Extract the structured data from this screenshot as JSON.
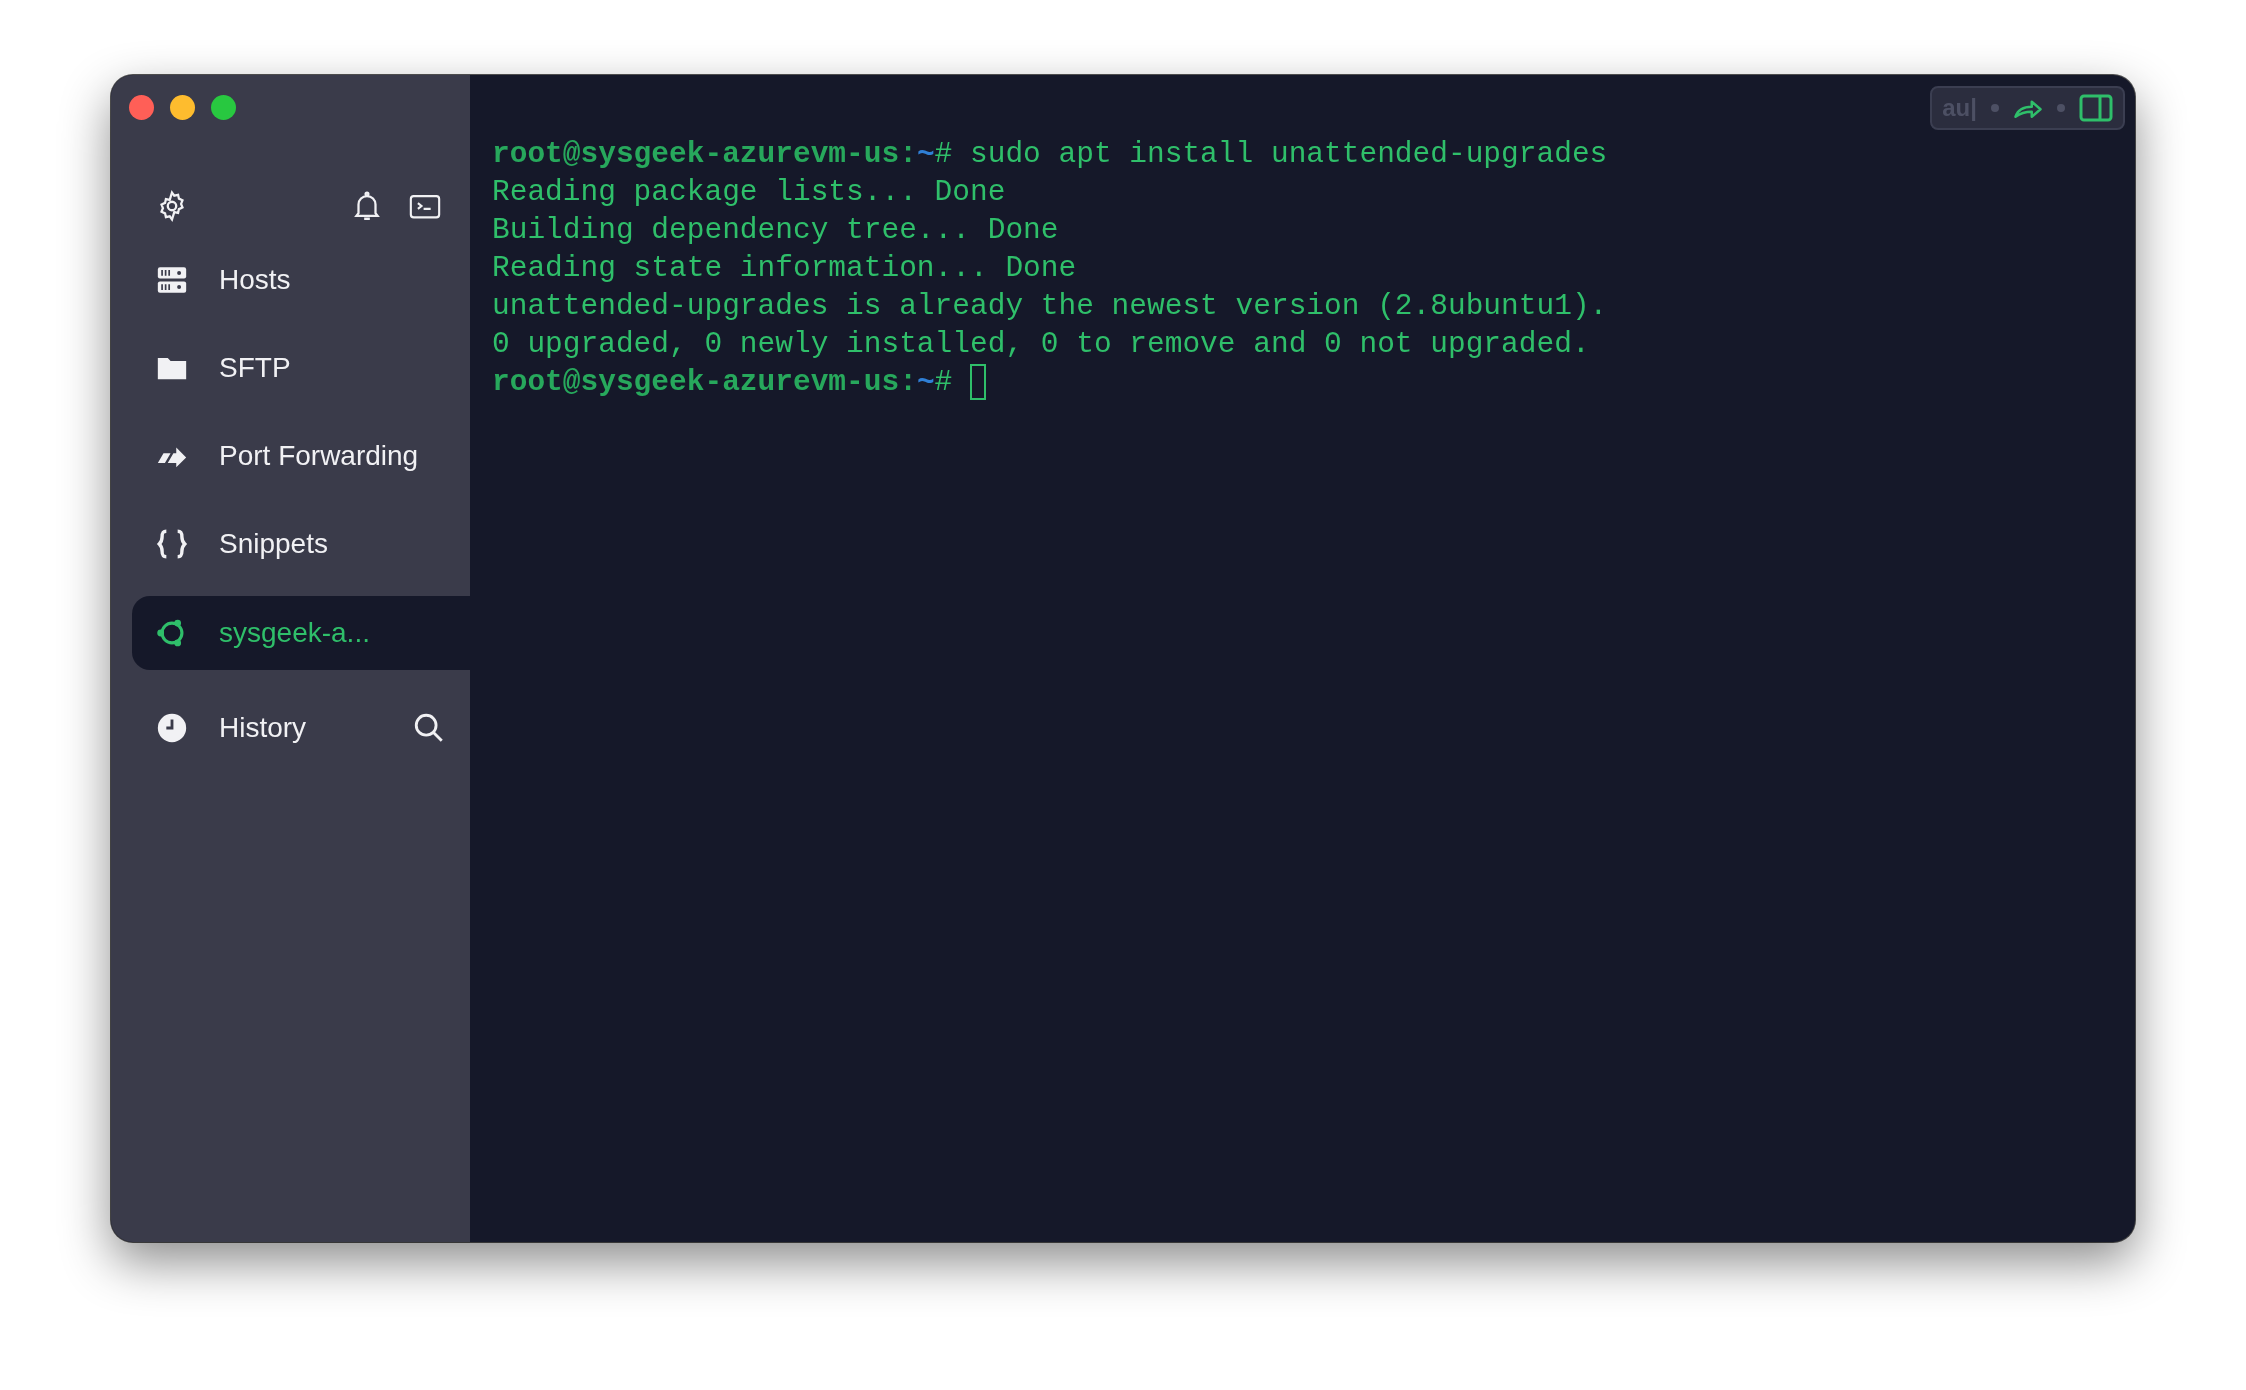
{
  "sidebar": {
    "items": [
      {
        "kind": "hosts",
        "label": "Hosts",
        "selected": false
      },
      {
        "kind": "sftp",
        "label": "SFTP",
        "selected": false
      },
      {
        "kind": "forwarding",
        "label": "Port Forwarding",
        "selected": false
      },
      {
        "kind": "snippets",
        "label": "Snippets",
        "selected": false
      },
      {
        "kind": "session",
        "label": "sysgeek-a...",
        "selected": true
      },
      {
        "kind": "history",
        "label": "History",
        "selected": false
      }
    ]
  },
  "toolbar": {
    "input_text": "au|"
  },
  "terminal": {
    "lines": [
      {
        "kind": "prompt",
        "user_host": "root@sysgeek-azurevm-us:",
        "path": "~",
        "symbol": "#",
        "command": " sudo apt install unattended-upgrades"
      },
      {
        "kind": "output",
        "text": "Reading package lists... Done"
      },
      {
        "kind": "output",
        "text": "Building dependency tree... Done"
      },
      {
        "kind": "output",
        "text": "Reading state information... Done"
      },
      {
        "kind": "output",
        "text": "unattended-upgrades is already the newest version (2.8ubuntu1)."
      },
      {
        "kind": "output",
        "text": "0 upgraded, 0 newly installed, 0 to remove and 0 not upgraded."
      },
      {
        "kind": "input",
        "user_host": "root@sysgeek-azurevm-us:",
        "path": "~",
        "symbol": "#"
      }
    ]
  }
}
